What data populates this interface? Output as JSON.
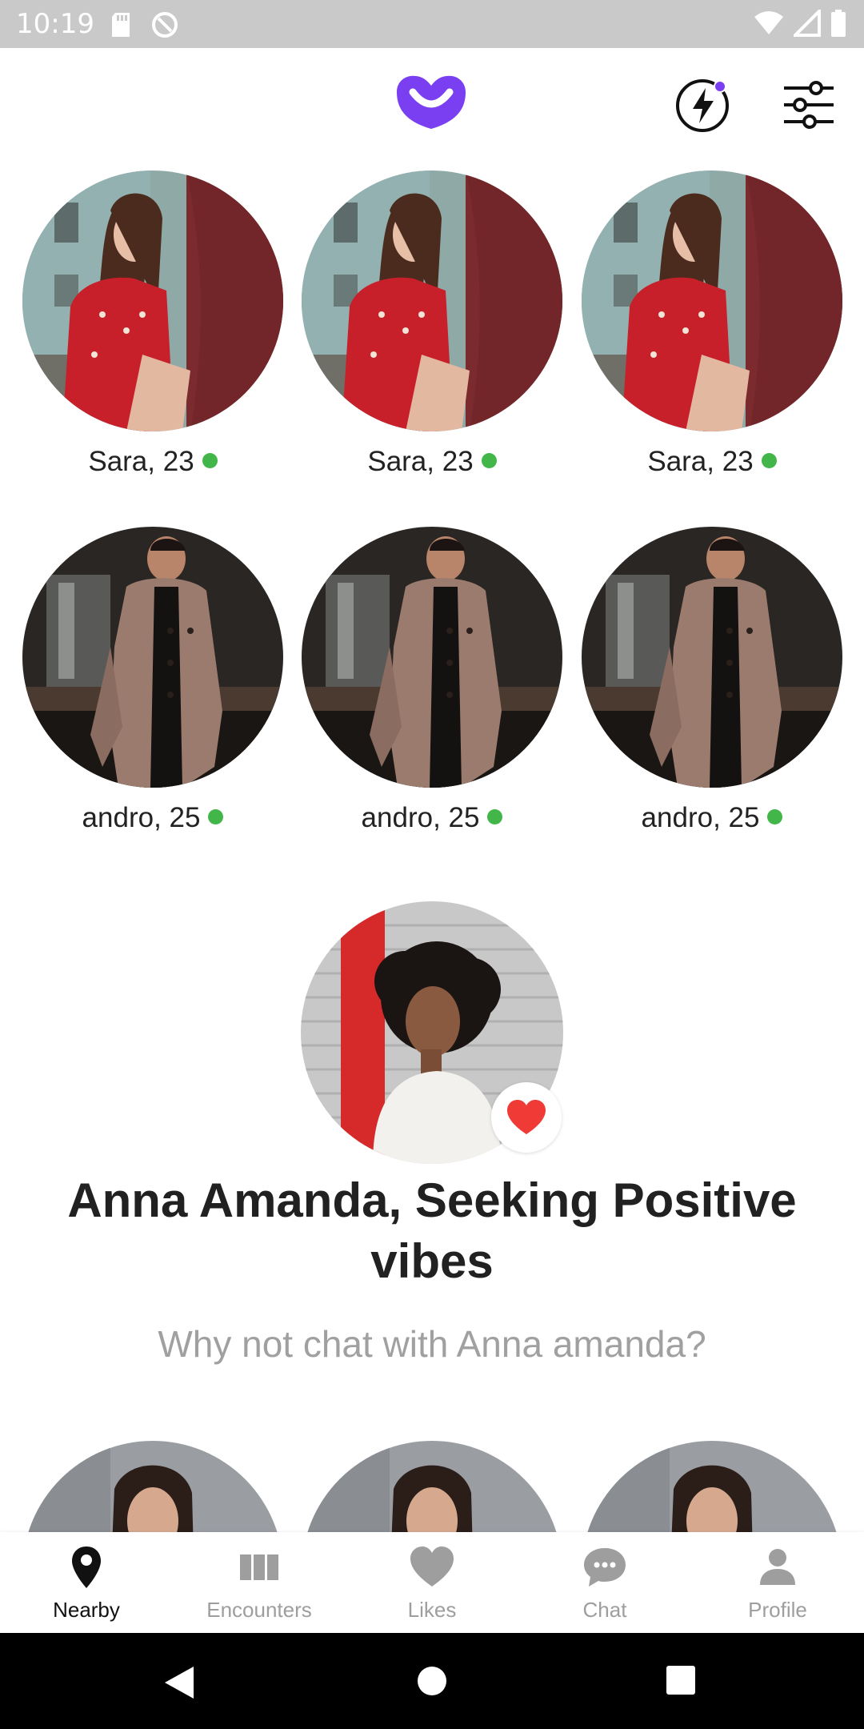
{
  "status_bar": {
    "time": "10:19"
  },
  "header": {
    "logo_icon": "smile-heart-logo",
    "brand_color": "#7b3ff2",
    "boost_icon": "lightning-icon",
    "filter_icon": "sliders-icon"
  },
  "nearby": {
    "rows": [
      {
        "people": [
          {
            "name": "Sara, 23"
          },
          {
            "name": "Sara, 23"
          },
          {
            "name": "Sara, 23"
          }
        ]
      },
      {
        "people": [
          {
            "name": "andro, 25"
          },
          {
            "name": "andro, 25"
          },
          {
            "name": "andro, 25"
          }
        ]
      }
    ],
    "online_color": "#43b649"
  },
  "featured": {
    "title": "Anna Amanda, Seeking Positive vibes",
    "subtitle": "Why not chat with Anna amanda?",
    "badge_icon": "heart-icon",
    "badge_color": "#ef3a36"
  },
  "bottom_nav": {
    "items": [
      {
        "label": "Nearby",
        "icon": "location-pin-icon",
        "active": true
      },
      {
        "label": "Encounters",
        "icon": "columns-icon",
        "active": false
      },
      {
        "label": "Likes",
        "icon": "heart-icon",
        "active": false
      },
      {
        "label": "Chat",
        "icon": "chat-bubble-icon",
        "active": false
      },
      {
        "label": "Profile",
        "icon": "person-icon",
        "active": false
      }
    ]
  }
}
